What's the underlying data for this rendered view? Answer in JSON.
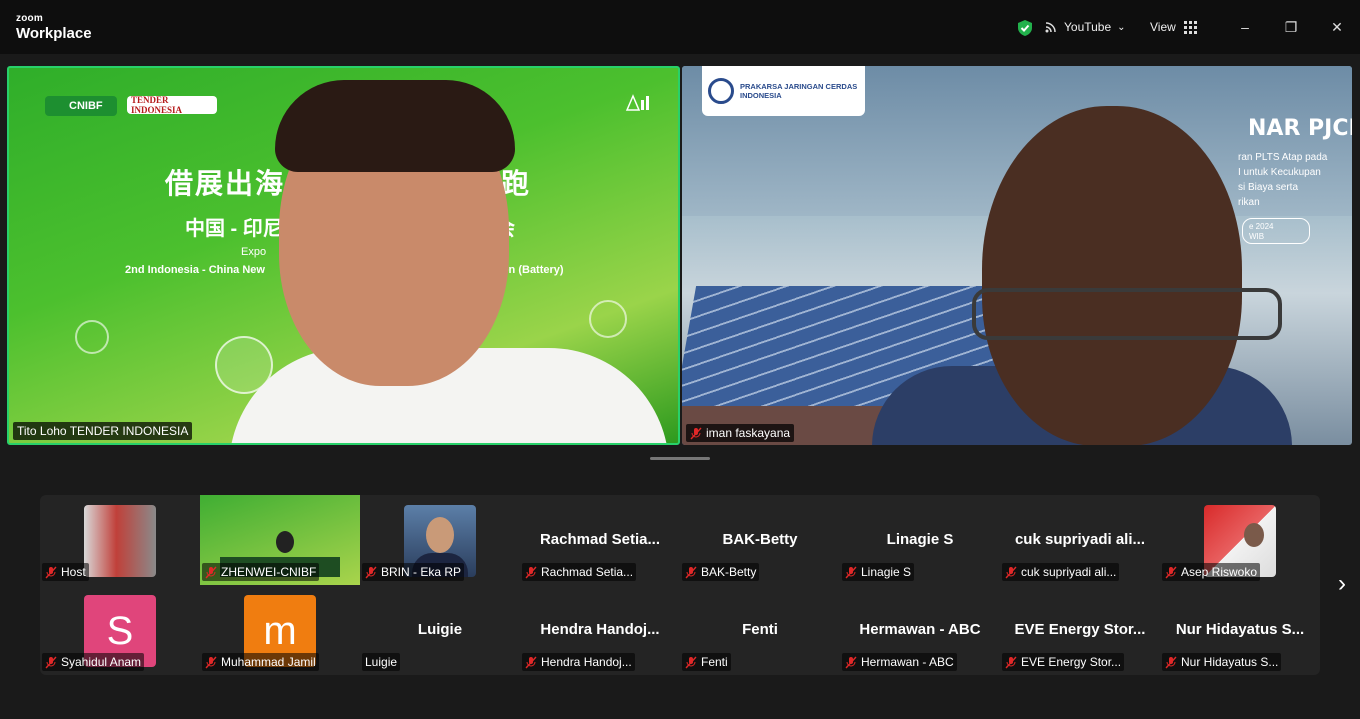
{
  "app": {
    "brand_small": "zoom",
    "brand_large": "Workplace"
  },
  "titlebar": {
    "streaming_label": "YouTube",
    "view_label": "View",
    "minimize": "–",
    "restore": "❐",
    "close": "✕"
  },
  "speakers": [
    {
      "name": "Tito Loho TENDER INDONESIA",
      "muted": false
    },
    {
      "name": "iman faskayana",
      "muted": true
    }
  ],
  "slide_a": {
    "logo1": "CNIBF",
    "logo2": "TENDER INDONESIA",
    "line1": "借展出海",
    "line1_end": "跑",
    "line2": "中国 - 印尼",
    "line2_end": "会",
    "line3": "Expo",
    "line4": "2nd Indonesia - China New",
    "line4_end": "ation (Battery)"
  },
  "slide_b": {
    "logo_text": "PRAKARSA JARINGAN CERDAS INDONESIA",
    "heading": "NAR PJCI",
    "body": [
      "ran PLTS Atap pada",
      "I untuk Kecukupan",
      "si Biaya serta",
      "rikan"
    ],
    "date": "e 2024",
    "time": "WIB"
  },
  "participants_row1": [
    {
      "big": "",
      "tag": "Host",
      "kind": "thumb-team"
    },
    {
      "big": "",
      "tag": "ZHENWEI-CNIBF",
      "kind": "thumb-slide"
    },
    {
      "big": "",
      "tag": "BRIN - Eka RP",
      "kind": "thumb-person"
    },
    {
      "big": "Rachmad Setia...",
      "tag": "Rachmad Setia...",
      "kind": "name"
    },
    {
      "big": "BAK-Betty",
      "tag": "BAK-Betty",
      "kind": "name"
    },
    {
      "big": "Linagie S",
      "tag": "Linagie S",
      "kind": "name"
    },
    {
      "big": "cuk supriyadi ali...",
      "tag": "cuk supriyadi ali...",
      "kind": "name"
    },
    {
      "big": "",
      "tag": "Asep Riswoko",
      "kind": "thumb-red"
    }
  ],
  "participants_row2": [
    {
      "big": "S",
      "tag": "Syahidul Anam",
      "kind": "letter",
      "color": "#e0457b"
    },
    {
      "big": "m",
      "tag": "Muhammad Jamil",
      "kind": "letter",
      "color": "#f07d10"
    },
    {
      "big": "Luigie",
      "tag": "Luigie",
      "kind": "name",
      "unmuted": true
    },
    {
      "big": "Hendra Handoj...",
      "tag": "Hendra Handoj...",
      "kind": "name"
    },
    {
      "big": "Fenti",
      "tag": "Fenti",
      "kind": "name"
    },
    {
      "big": "Hermawan - ABC",
      "tag": "Hermawan - ABC",
      "kind": "name"
    },
    {
      "big": "EVE Energy Stor...",
      "tag": "EVE Energy Stor...",
      "kind": "name"
    },
    {
      "big": "Nur Hidayatus S...",
      "tag": "Nur Hidayatus S...",
      "kind": "name"
    }
  ]
}
